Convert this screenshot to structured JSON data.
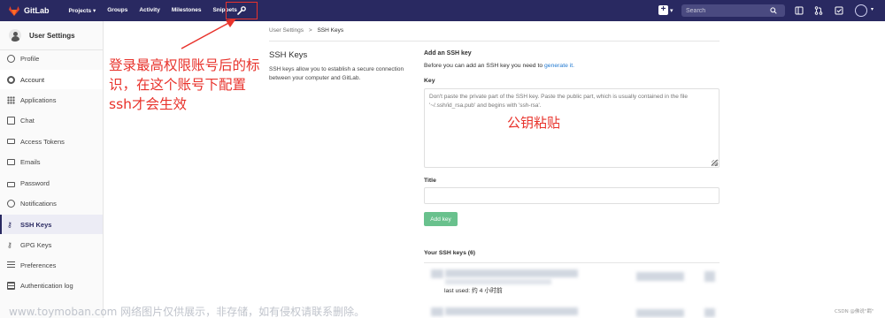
{
  "topbar": {
    "brand": "GitLab",
    "nav": [
      "Projects ▾",
      "Groups",
      "Activity",
      "Milestones",
      "Snippets"
    ],
    "search_placeholder": "Search",
    "plus_caret": "▾",
    "avatar_caret": "▾"
  },
  "sidebar": {
    "title": "User Settings",
    "items": [
      {
        "label": "Profile",
        "icon": "profile-icon"
      },
      {
        "label": "Account",
        "icon": "account-icon"
      },
      {
        "label": "Applications",
        "icon": "applications-icon"
      },
      {
        "label": "Chat",
        "icon": "chat-icon"
      },
      {
        "label": "Access Tokens",
        "icon": "access-tokens-icon"
      },
      {
        "label": "Emails",
        "icon": "email-icon"
      },
      {
        "label": "Password",
        "icon": "lock-icon"
      },
      {
        "label": "Notifications",
        "icon": "bell-icon"
      },
      {
        "label": "SSH Keys",
        "icon": "key-icon"
      },
      {
        "label": "GPG Keys",
        "icon": "key-icon"
      },
      {
        "label": "Preferences",
        "icon": "sliders-icon"
      },
      {
        "label": "Authentication log",
        "icon": "log-icon"
      }
    ]
  },
  "breadcrumb": {
    "parent": "User Settings",
    "separator": ">",
    "current": "SSH Keys"
  },
  "left_panel": {
    "title": "SSH Keys",
    "description": "SSH keys allow you to establish a secure connection between your computer and GitLab."
  },
  "form": {
    "heading": "Add an SSH key",
    "intro": "Before you can add an SSH key you need to",
    "intro_link": "generate it.",
    "key_label": "Key",
    "key_placeholder": "Don't paste the private part of the SSH key. Paste the public part, which is usually contained in the file '~/.ssh/id_rsa.pub' and begins with 'ssh-rsa'.",
    "title_label": "Title",
    "title_value": "",
    "add_button": "Add key"
  },
  "keys_list": {
    "heading": "Your SSH keys (6)",
    "first_key_last_used": "last used: 约 4 小时前"
  },
  "annotations": {
    "left_note": "登录最高权限账号后的标识，在这个账号下配置ssh才会生效",
    "key_note": "公钥粘贴"
  },
  "watermark": "www.toymoban.com 网络图片仅供展示，非存储，如有侵权请联系删除。",
  "credit": "CSDN @佛说\"羁\"",
  "colors": {
    "navbar": "#292961",
    "annotation_red": "#e8322b",
    "add_button": "#69c18d",
    "link": "#1f78d1"
  }
}
